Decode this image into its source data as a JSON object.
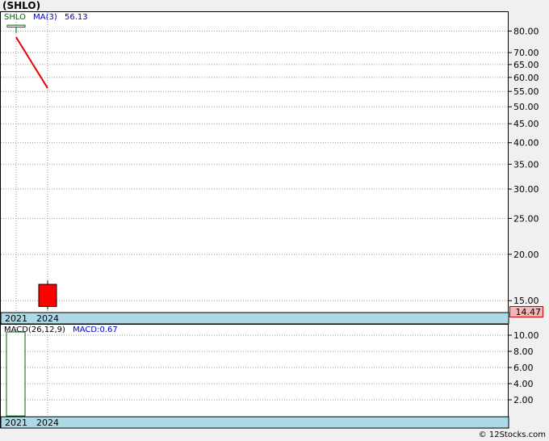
{
  "title": "(SHLO)",
  "footer": "© 12Stocks.com",
  "legend_main": {
    "symbol": "SHLO",
    "ma_label": "MA(3)",
    "ma_value": "56.13"
  },
  "legend_macd": {
    "label": "MACD(26,12,9)",
    "value_label": "MACD:0.67"
  },
  "price_tag": "14.47",
  "colors": {
    "bull": "#006400",
    "bear": "#ff0000",
    "ma": "#e00000",
    "axis_band": "#add8e6",
    "macd_bar": "#006400"
  },
  "chart_data": [
    {
      "type": "candlestick",
      "scale": "log",
      "x": [
        "2021",
        "2024"
      ],
      "candles": [
        {
          "x": "2021",
          "open": 82.0,
          "high": 83.0,
          "low": 79.0,
          "close": 83.0
        },
        {
          "x": "2024",
          "open": 16.6,
          "high": 17.0,
          "low": 14.2,
          "close": 14.47
        }
      ],
      "ma_series": {
        "name": "MA(3)",
        "points": [
          {
            "x": "2021",
            "y": 77
          },
          {
            "x": "2024",
            "y": 56.13
          }
        ]
      },
      "y_ticks": [
        80.0,
        70.0,
        65.0,
        60.0,
        55.0,
        50.0,
        45.0,
        40.0,
        35.0,
        30.0,
        25.0,
        20.0,
        15.0
      ],
      "y_tick_labels": [
        "80.00",
        "70.00",
        "65.00",
        "60.00",
        "55.00",
        "50.00",
        "45.00",
        "40.00",
        "35.00",
        "30.00",
        "25.00",
        "20.00",
        "15.00"
      ],
      "x_tick_labels": [
        "2021",
        "2024"
      ],
      "ylim": [
        14.0,
        90.0
      ],
      "grid": true
    },
    {
      "type": "bar",
      "name": "MACD(26,12,9)",
      "x": [
        "2021"
      ],
      "values": [
        10.4
      ],
      "y_ticks": [
        2.0,
        4.0,
        6.0,
        8.0,
        10.0
      ],
      "y_tick_labels": [
        "2.00",
        "4.00",
        "6.00",
        "8.00",
        "10.00"
      ],
      "x_tick_labels": [
        "2021",
        "2024"
      ],
      "ylim": [
        0.0,
        11.3
      ],
      "grid": true
    }
  ]
}
